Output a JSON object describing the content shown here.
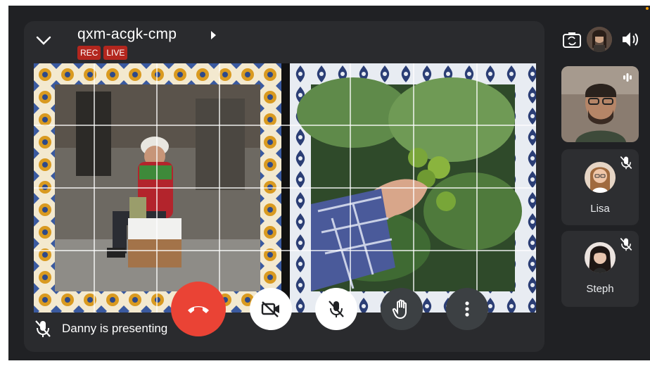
{
  "meeting": {
    "code": "qxm-acgk-cmp",
    "badges": [
      "REC",
      "LIVE"
    ]
  },
  "presentation": {
    "status_text": "Danny is presenting"
  },
  "controls": [
    {
      "name": "end-call-button",
      "icon": "call-end-icon",
      "color": "#ea4335"
    },
    {
      "name": "camera-toggle-button",
      "icon": "videocam-off-icon"
    },
    {
      "name": "mic-toggle-button",
      "icon": "mic-off-icon"
    },
    {
      "name": "raise-hand-button",
      "icon": "hand-icon"
    },
    {
      "name": "more-options-button",
      "icon": "more-vert-icon"
    }
  ],
  "participants": [
    {
      "name": "",
      "speaking": true
    },
    {
      "name": "Lisa",
      "muted": true
    },
    {
      "name": "Steph",
      "muted": true
    }
  ],
  "colors": {
    "background": "#202124",
    "tile": "#2d2e31",
    "badge_red": "#b3261e",
    "end_call": "#ea4335"
  }
}
